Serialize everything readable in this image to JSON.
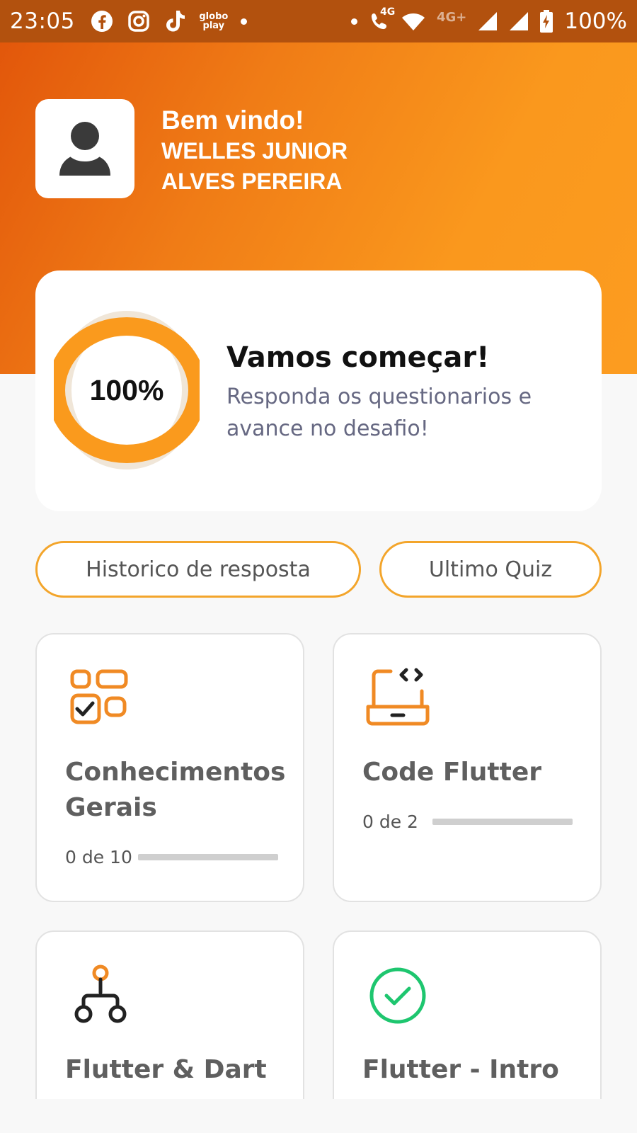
{
  "status_bar": {
    "time": "23:05",
    "app_icons": [
      "facebook-icon",
      "instagram-icon",
      "tiktok-icon",
      "globoplay-icon"
    ],
    "globoplay_label": "globo play",
    "network_4g": "4G",
    "network_4g_plus": "4G+",
    "battery": "100%"
  },
  "header": {
    "welcome": "Bem vindo!",
    "user_name": "WELLES JUNIOR ALVES PEREIRA",
    "avatar_icon": "person-icon"
  },
  "progress_card": {
    "percent_label": "100%",
    "percent_value": 1.0,
    "title": "Vamos começar!",
    "subtitle": "Responda os questionarios e avance no desafio!"
  },
  "buttons": {
    "history": "Historico de resposta",
    "last_quiz": "Ultimo Quiz"
  },
  "quiz_cards": [
    {
      "title": "Conhecimentos Gerais",
      "progress_text": "0 de 10",
      "answered": 0,
      "total": 10,
      "icon": "checklist-grid-icon"
    },
    {
      "title": "Code Flutter",
      "progress_text": "0 de 2",
      "answered": 0,
      "total": 2,
      "icon": "laptop-code-icon"
    },
    {
      "title": "Flutter & Dart",
      "icon": "hierarchy-icon"
    },
    {
      "title": "Flutter - Intro",
      "icon": "check-circle-icon"
    }
  ],
  "colors": {
    "accent": "#f3a52b",
    "ring": "#fa9a1d",
    "gradient_start": "#e2570b",
    "gradient_end": "#fc9c20",
    "check_green": "#1ec66f"
  }
}
